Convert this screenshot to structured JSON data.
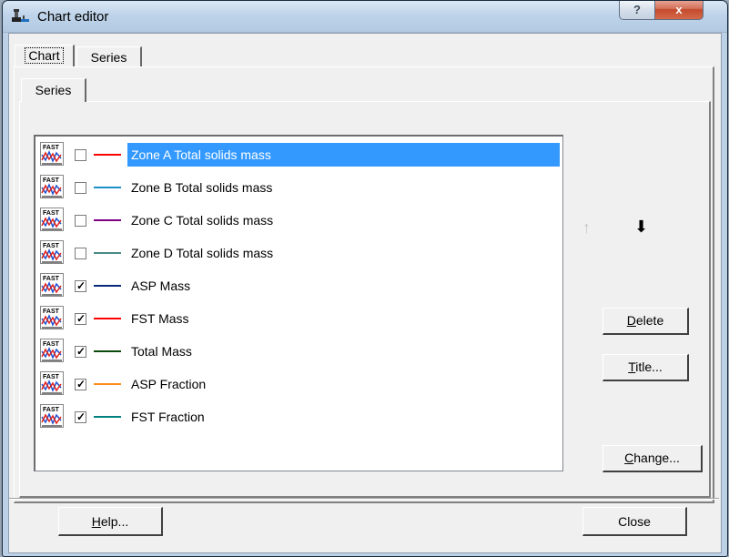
{
  "window": {
    "title": "Chart editor",
    "help_label": "?",
    "close_label": "x"
  },
  "tabs": [
    {
      "label": "Chart",
      "active": true
    },
    {
      "label": "Series",
      "active": false
    }
  ],
  "inner_tab": {
    "label": "Series"
  },
  "series_list": [
    {
      "name": "Zone A Total solids mass",
      "checked": false,
      "color": "#ff0000",
      "selected": true
    },
    {
      "name": "Zone B Total solids mass",
      "checked": false,
      "color": "#1e90c8",
      "selected": false
    },
    {
      "name": "Zone C Total solids mass",
      "checked": false,
      "color": "#800080",
      "selected": false
    },
    {
      "name": "Zone D Total solids mass",
      "checked": false,
      "color": "#4a8a8a",
      "selected": false
    },
    {
      "name": "ASP Mass",
      "checked": true,
      "color": "#0a2a7a",
      "selected": false
    },
    {
      "name": "FST Mass",
      "checked": true,
      "color": "#ff0000",
      "selected": false
    },
    {
      "name": "Total Mass",
      "checked": true,
      "color": "#0a4a0a",
      "selected": false
    },
    {
      "name": "ASP Fraction",
      "checked": true,
      "color": "#ff8c1a",
      "selected": false
    },
    {
      "name": "FST Fraction",
      "checked": true,
      "color": "#008080",
      "selected": false
    }
  ],
  "series_icon": {
    "text": "FAST"
  },
  "arrows": {
    "up": "↑",
    "down": "⬇"
  },
  "buttons": {
    "delete": {
      "mnemonic": "D",
      "rest": "elete"
    },
    "title": {
      "mnemonic": "T",
      "rest": "itle..."
    },
    "change": {
      "mnemonic": "C",
      "rest": "hange..."
    },
    "help": {
      "mnemonic": "H",
      "rest": "elp..."
    },
    "close": "Close"
  }
}
